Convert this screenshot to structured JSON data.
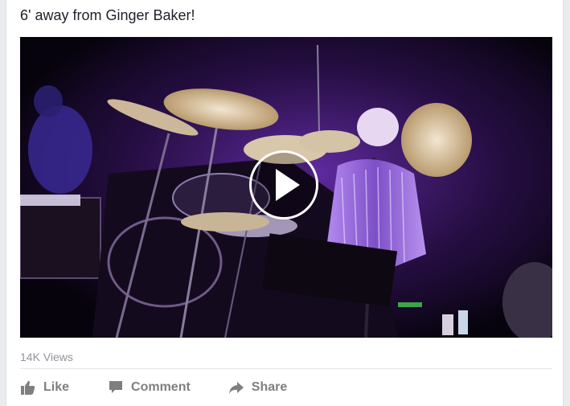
{
  "post": {
    "text": "6' away from Ginger Baker!"
  },
  "video": {
    "play_icon": "play-icon",
    "views": "14K Views"
  },
  "actions": {
    "like": {
      "label": "Like",
      "icon": "thumbs-up-icon"
    },
    "comment": {
      "label": "Comment",
      "icon": "speech-bubble-icon"
    },
    "share": {
      "label": "Share",
      "icon": "share-arrow-icon"
    }
  },
  "colors": {
    "text": "#1d2129",
    "muted": "#90949c",
    "action": "#7f7f7f",
    "stage_light": "#9b4ddb"
  }
}
